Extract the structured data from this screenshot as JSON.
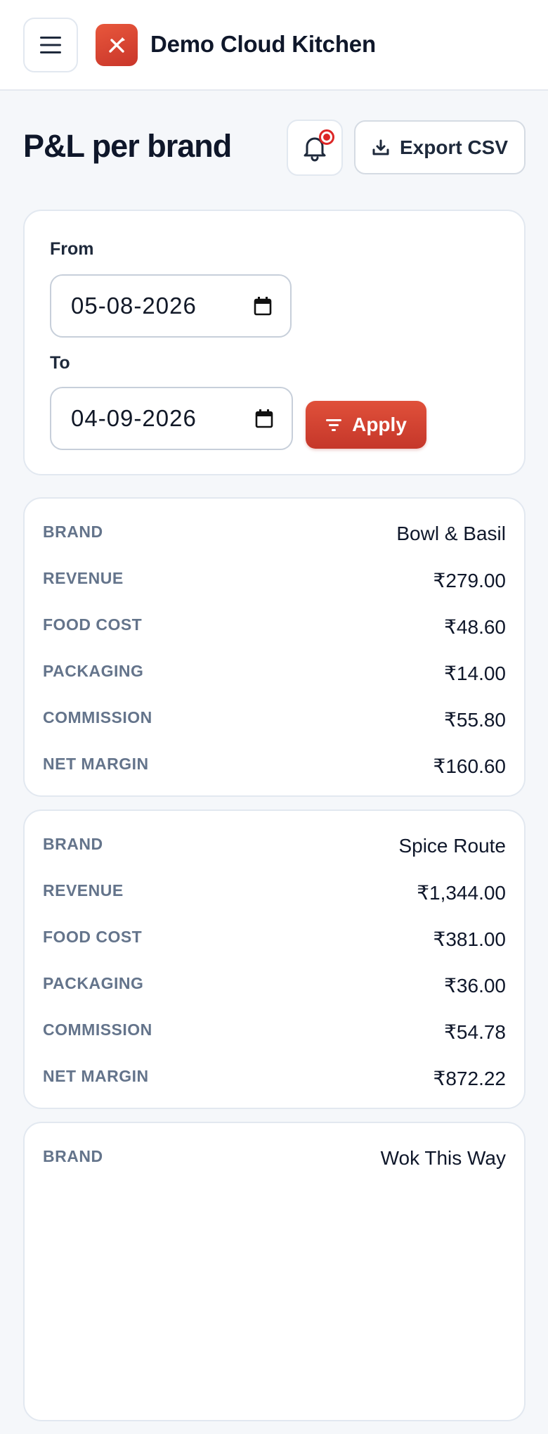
{
  "header": {
    "app_title": "Demo Cloud Kitchen",
    "menu_icon": "hamburger-menu-icon",
    "logo_icon": "fork-knife-icon"
  },
  "page": {
    "title": "P&L per brand",
    "export_label": "Export CSV",
    "notification_icon": "bell-icon"
  },
  "filters": {
    "from_label": "From",
    "from_value": "05-08-2026",
    "to_label": "To",
    "to_value": "04-09-2026",
    "apply_label": "Apply"
  },
  "labels": {
    "brand": "BRAND",
    "revenue": "REVENUE",
    "food_cost": "FOOD COST",
    "packaging": "PACKAGING",
    "commission": "COMMISSION",
    "net_margin": "NET MARGIN"
  },
  "brands": [
    {
      "brand": "Bowl & Basil",
      "revenue": "₹279.00",
      "food_cost": "₹48.60",
      "packaging": "₹14.00",
      "commission": "₹55.80",
      "net_margin": "₹160.60"
    },
    {
      "brand": "Spice Route",
      "revenue": "₹1,344.00",
      "food_cost": "₹381.00",
      "packaging": "₹36.00",
      "commission": "₹54.78",
      "net_margin": "₹872.22"
    },
    {
      "brand": "Wok This Way"
    }
  ],
  "colors": {
    "accent": "#d9432f",
    "label": "#64748b",
    "border": "#e2e8f0",
    "background": "#f5f7fa"
  }
}
